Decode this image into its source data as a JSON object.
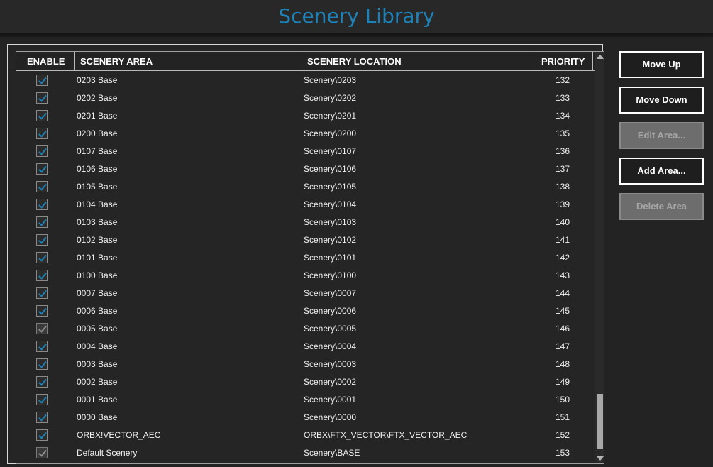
{
  "window": {
    "title": "Scenery Library"
  },
  "accent_color": "#1d82b8",
  "table": {
    "columns": {
      "enable": "ENABLE",
      "area": "SCENERY AREA",
      "location": "SCENERY LOCATION",
      "priority": "PRIORITY"
    },
    "rows": [
      {
        "enabled": true,
        "dim": false,
        "area": "0203 Base",
        "location": "Scenery\\0203",
        "priority": "132"
      },
      {
        "enabled": true,
        "dim": false,
        "area": "0202 Base",
        "location": "Scenery\\0202",
        "priority": "133"
      },
      {
        "enabled": true,
        "dim": false,
        "area": "0201 Base",
        "location": "Scenery\\0201",
        "priority": "134"
      },
      {
        "enabled": true,
        "dim": false,
        "area": "0200 Base",
        "location": "Scenery\\0200",
        "priority": "135"
      },
      {
        "enabled": true,
        "dim": false,
        "area": "0107 Base",
        "location": "Scenery\\0107",
        "priority": "136"
      },
      {
        "enabled": true,
        "dim": false,
        "area": "0106 Base",
        "location": "Scenery\\0106",
        "priority": "137"
      },
      {
        "enabled": true,
        "dim": false,
        "area": "0105 Base",
        "location": "Scenery\\0105",
        "priority": "138"
      },
      {
        "enabled": true,
        "dim": false,
        "area": "0104 Base",
        "location": "Scenery\\0104",
        "priority": "139"
      },
      {
        "enabled": true,
        "dim": false,
        "area": "0103 Base",
        "location": "Scenery\\0103",
        "priority": "140"
      },
      {
        "enabled": true,
        "dim": false,
        "area": "0102 Base",
        "location": "Scenery\\0102",
        "priority": "141"
      },
      {
        "enabled": true,
        "dim": false,
        "area": "0101 Base",
        "location": "Scenery\\0101",
        "priority": "142"
      },
      {
        "enabled": true,
        "dim": false,
        "area": "0100 Base",
        "location": "Scenery\\0100",
        "priority": "143"
      },
      {
        "enabled": true,
        "dim": false,
        "area": "0007 Base",
        "location": "Scenery\\0007",
        "priority": "144"
      },
      {
        "enabled": true,
        "dim": false,
        "area": "0006 Base",
        "location": "Scenery\\0006",
        "priority": "145"
      },
      {
        "enabled": true,
        "dim": true,
        "area": "0005 Base",
        "location": "Scenery\\0005",
        "priority": "146"
      },
      {
        "enabled": true,
        "dim": false,
        "area": "0004 Base",
        "location": "Scenery\\0004",
        "priority": "147"
      },
      {
        "enabled": true,
        "dim": false,
        "area": "0003 Base",
        "location": "Scenery\\0003",
        "priority": "148"
      },
      {
        "enabled": true,
        "dim": false,
        "area": "0002 Base",
        "location": "Scenery\\0002",
        "priority": "149"
      },
      {
        "enabled": true,
        "dim": false,
        "area": "0001 Base",
        "location": "Scenery\\0001",
        "priority": "150"
      },
      {
        "enabled": true,
        "dim": false,
        "area": "0000 Base",
        "location": "Scenery\\0000",
        "priority": "151"
      },
      {
        "enabled": true,
        "dim": false,
        "area": "ORBX!VECTOR_AEC",
        "location": "ORBX\\FTX_VECTOR\\FTX_VECTOR_AEC",
        "priority": "152"
      },
      {
        "enabled": true,
        "dim": true,
        "area": "Default Scenery",
        "location": "Scenery\\BASE",
        "priority": "153"
      }
    ]
  },
  "buttons": {
    "move_up": "Move Up",
    "move_down": "Move Down",
    "edit_area": "Edit Area...",
    "add_area": "Add Area...",
    "delete_area": "Delete Area"
  }
}
